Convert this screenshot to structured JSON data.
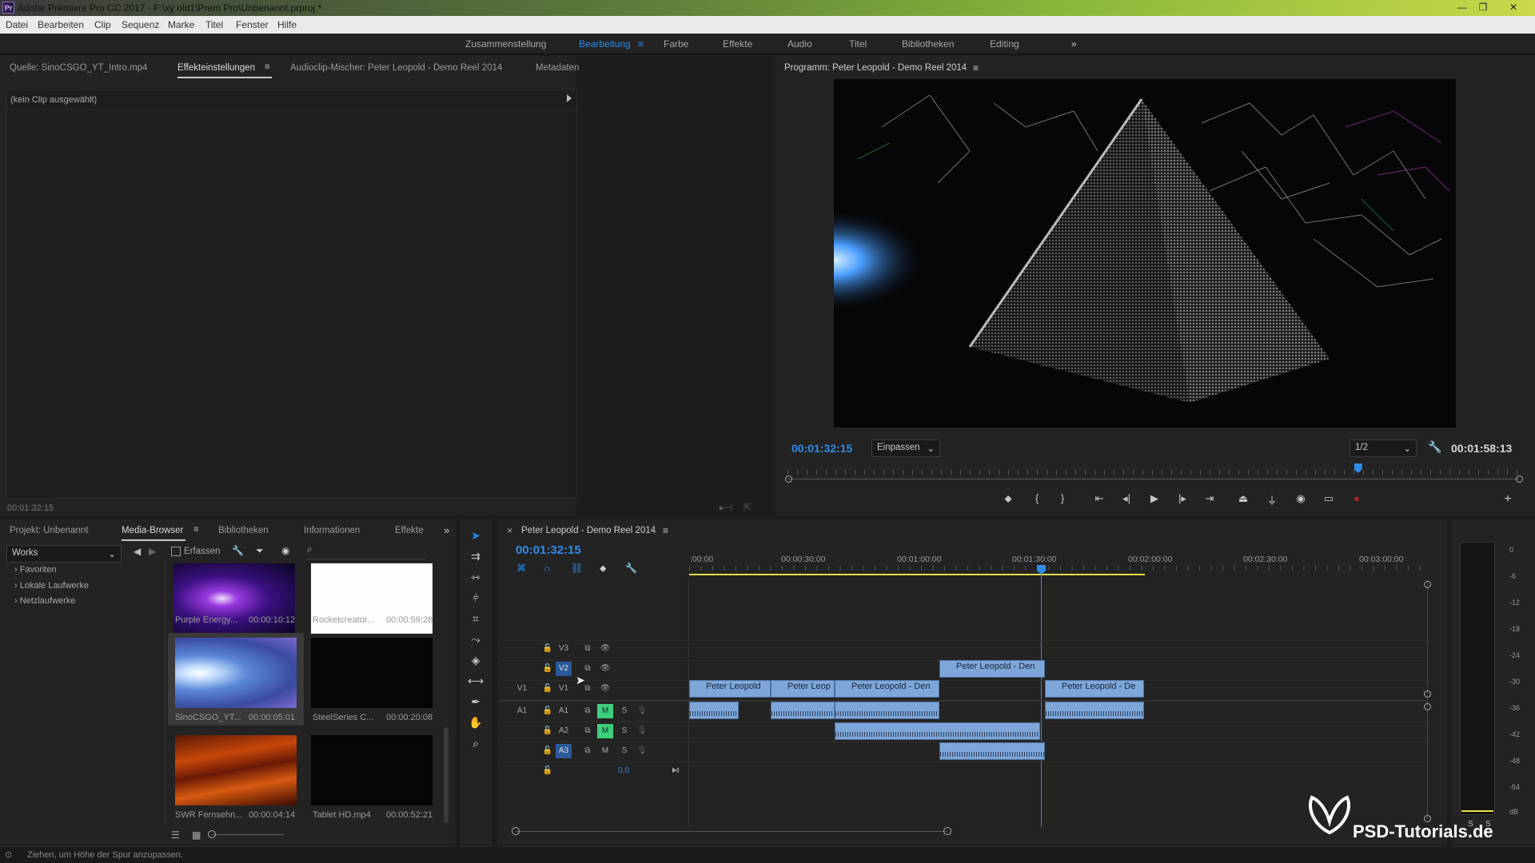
{
  "window": {
    "title": "Adobe Premiere Pro CC 2017 - F:\\xy old1\\Prem Pro\\Unbenannt.prproj *",
    "logo": "Pr"
  },
  "menu": [
    "Datei",
    "Bearbeiten",
    "Clip",
    "Sequenz",
    "Marke",
    "Titel",
    "Fenster",
    "Hilfe"
  ],
  "workspaces": [
    "Zusammenstellung",
    "Bearbeitung",
    "Farbe",
    "Effekte",
    "Audio",
    "Titel",
    "Bibliotheken",
    "Editing"
  ],
  "workspace_more": "»",
  "source_panel": {
    "tabs": [
      "Quelle: SinoCSGO_YT_Intro.mp4",
      "Effekteinstellungen",
      "Audioclip-Mischer: Peter Leopold - Demo Reel 2014",
      "Metadaten"
    ],
    "empty_text": "(kein Clip ausgewählt)",
    "timecode": "00:01:32:15"
  },
  "program": {
    "title": "Programm: Peter Leopold - Demo Reel 2014",
    "timecode": "00:01:32:15",
    "fit": "Einpassen",
    "resolution": "1/2",
    "duration": "00:01:58:13",
    "playhead_fraction": 0.78
  },
  "project_panel": {
    "tabs": [
      "Projekt: Unbenannt",
      "Media-Browser",
      "Bibliotheken",
      "Informationen",
      "Effekte"
    ],
    "more": "»",
    "location": "Works",
    "capture_label": "Erfassen",
    "tree": [
      "Favoriten",
      "Lokale Laufwerke",
      "Netzlaufwerke"
    ],
    "items": [
      {
        "name": "Purple Energy...",
        "duration": "00:00:10:12"
      },
      {
        "name": "Rocketcreator...",
        "duration": "00:00:59:28"
      },
      {
        "name": "SinoCSGO_YT...",
        "duration": "00:00:05:01"
      },
      {
        "name": "SteelSeries C...",
        "duration": "00:00:20:08"
      },
      {
        "name": "SWR Fernsehn...",
        "duration": "00:00:04:14"
      },
      {
        "name": "Tablet HD.mp4",
        "duration": "00:00:52:21"
      }
    ]
  },
  "timeline": {
    "sequence": "Peter Leopold - Demo Reel 2014",
    "timecode": "00:01:32:15",
    "ruler": [
      ":00:00",
      "00:00:30:00",
      "00:01:00:00",
      "00:01:30:00",
      "00:02:00:00",
      "00:02:30:00",
      "00:03:00:00"
    ],
    "tracks_video": [
      "V3",
      "V2",
      "V1"
    ],
    "tracks_audio": [
      "A1",
      "A2",
      "A3"
    ],
    "source_patch_v": "V1",
    "source_patch_a": "A1",
    "mute": "M",
    "solo": "S",
    "master_value": "0,0",
    "clip_name": "Peter Leopold - Demo Reel 2014",
    "clips": [
      {
        "label": "Peter Leopold"
      },
      {
        "label": "Peter Leop"
      },
      {
        "label": "Peter Leopold - Den"
      },
      {
        "label": "Peter Leopold - Den"
      },
      {
        "label": "Peter Leopold - De"
      }
    ]
  },
  "meter": {
    "scale": [
      "0",
      "-6",
      "-12",
      "-18",
      "-24",
      "-30",
      "-36",
      "-42",
      "-48",
      "-54",
      "dB"
    ],
    "bottom": [
      "S",
      "S"
    ]
  },
  "watermark": "PSD-Tutorials.de",
  "status": "Ziehen, um Höhe der Spur anzupassen.",
  "colors": {
    "accent": "#2d8ceb",
    "clip": "#7ea6d8",
    "mute_on": "#3ecf7a"
  }
}
